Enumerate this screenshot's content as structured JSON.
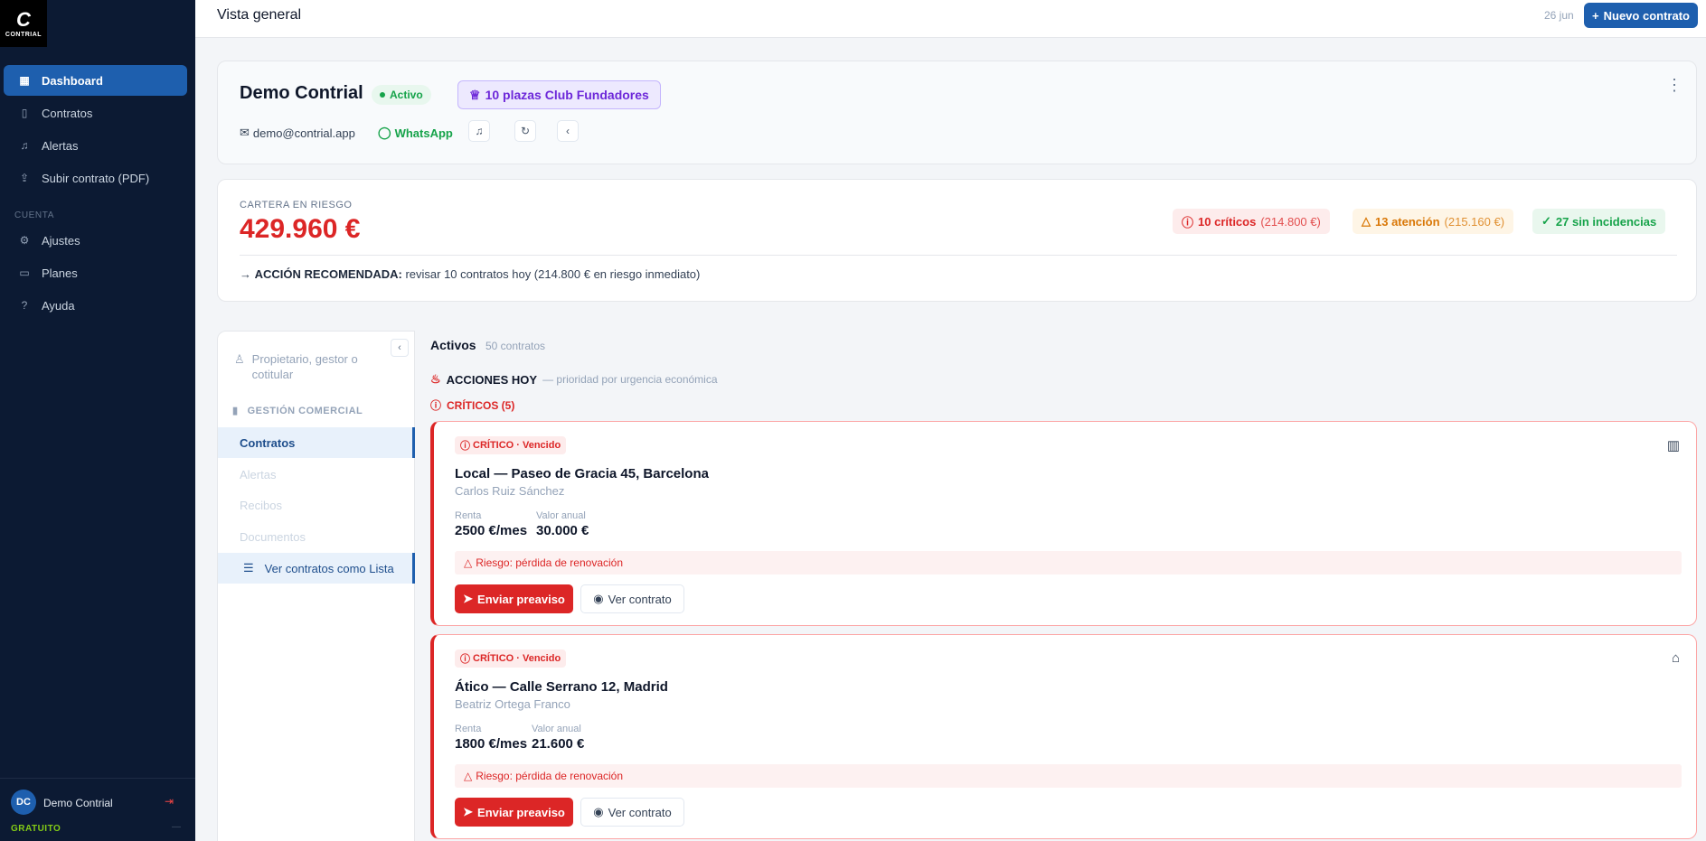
{
  "sidebar": {
    "logo_mark": "C",
    "logo_text": "CONTRIAL",
    "items": [
      {
        "label": "Dashboard",
        "icon": "dashboard-icon"
      },
      {
        "label": "Contratos",
        "icon": "document-icon"
      },
      {
        "label": "Alertas",
        "icon": "bell-icon"
      },
      {
        "label": "Subir contrato (PDF)",
        "icon": "upload-icon"
      }
    ],
    "section_label": "CUENTA",
    "account_items": [
      {
        "label": "Ajustes",
        "icon": "gear-icon"
      },
      {
        "label": "Planes",
        "icon": "card-icon"
      },
      {
        "label": "Ayuda",
        "icon": "help-icon"
      }
    ],
    "user_initials": "DC",
    "user_name": "Demo Contrial",
    "plan": "GRATUITO",
    "plan_extra": "—"
  },
  "topbar": {
    "title": "Vista general",
    "date": "26 jun",
    "new_button": "Nuevo contrato"
  },
  "company": {
    "name": "Demo Contrial",
    "status": "Activo",
    "club_badge": "10 plazas Club Fundadores",
    "email": "demo@contrial.app",
    "whatsapp": "WhatsApp"
  },
  "risk": {
    "label": "CARTERA EN RIESGO",
    "amount": "429.960 €",
    "critical": {
      "label": "10 críticos",
      "amount": "(214.800 €)"
    },
    "attention": {
      "label": "13 atención",
      "amount": "(215.160 €)"
    },
    "ok": {
      "label": "27 sin incidencias"
    },
    "reco_label": "ACCIÓN RECOMENDADA:",
    "reco_text": " revisar 10 contratos hoy (214.800 € en riesgo inmediato)"
  },
  "left_panel": {
    "owner_placeholder": "Propietario, gestor o cotitular",
    "section": "GESTIÓN COMERCIAL",
    "items": [
      "Contratos",
      "Alertas",
      "Recibos",
      "Documentos"
    ],
    "list_view": "Ver contratos como Lista"
  },
  "main": {
    "title": "Activos",
    "count": "50 contratos",
    "today_title": "ACCIONES HOY",
    "today_sub": "— prioridad por urgencia económica",
    "critical_header": "CRÍTICOS (5)",
    "rent_label": "Renta",
    "annual_label": "Valor anual",
    "send_button": "Enviar preaviso",
    "view_button": "Ver contrato",
    "contracts": [
      {
        "badge": "CRÍTICO · Vencido",
        "title": "Local — Paseo de Gracia 45, Barcelona",
        "tenant": "Carlos Ruiz Sánchez",
        "rent": "2500 €/mes",
        "annual": "30.000 €",
        "risk": "Riesgo: pérdida de renovación",
        "type_icon": "building-icon"
      },
      {
        "badge": "CRÍTICO · Vencido",
        "title": "Ático — Calle Serrano 12, Madrid",
        "tenant": "Beatriz Ortega Franco",
        "rent": "1800 €/mes",
        "annual": "21.600 €",
        "risk": "Riesgo: pérdida de renovación",
        "type_icon": "home-icon"
      }
    ]
  }
}
